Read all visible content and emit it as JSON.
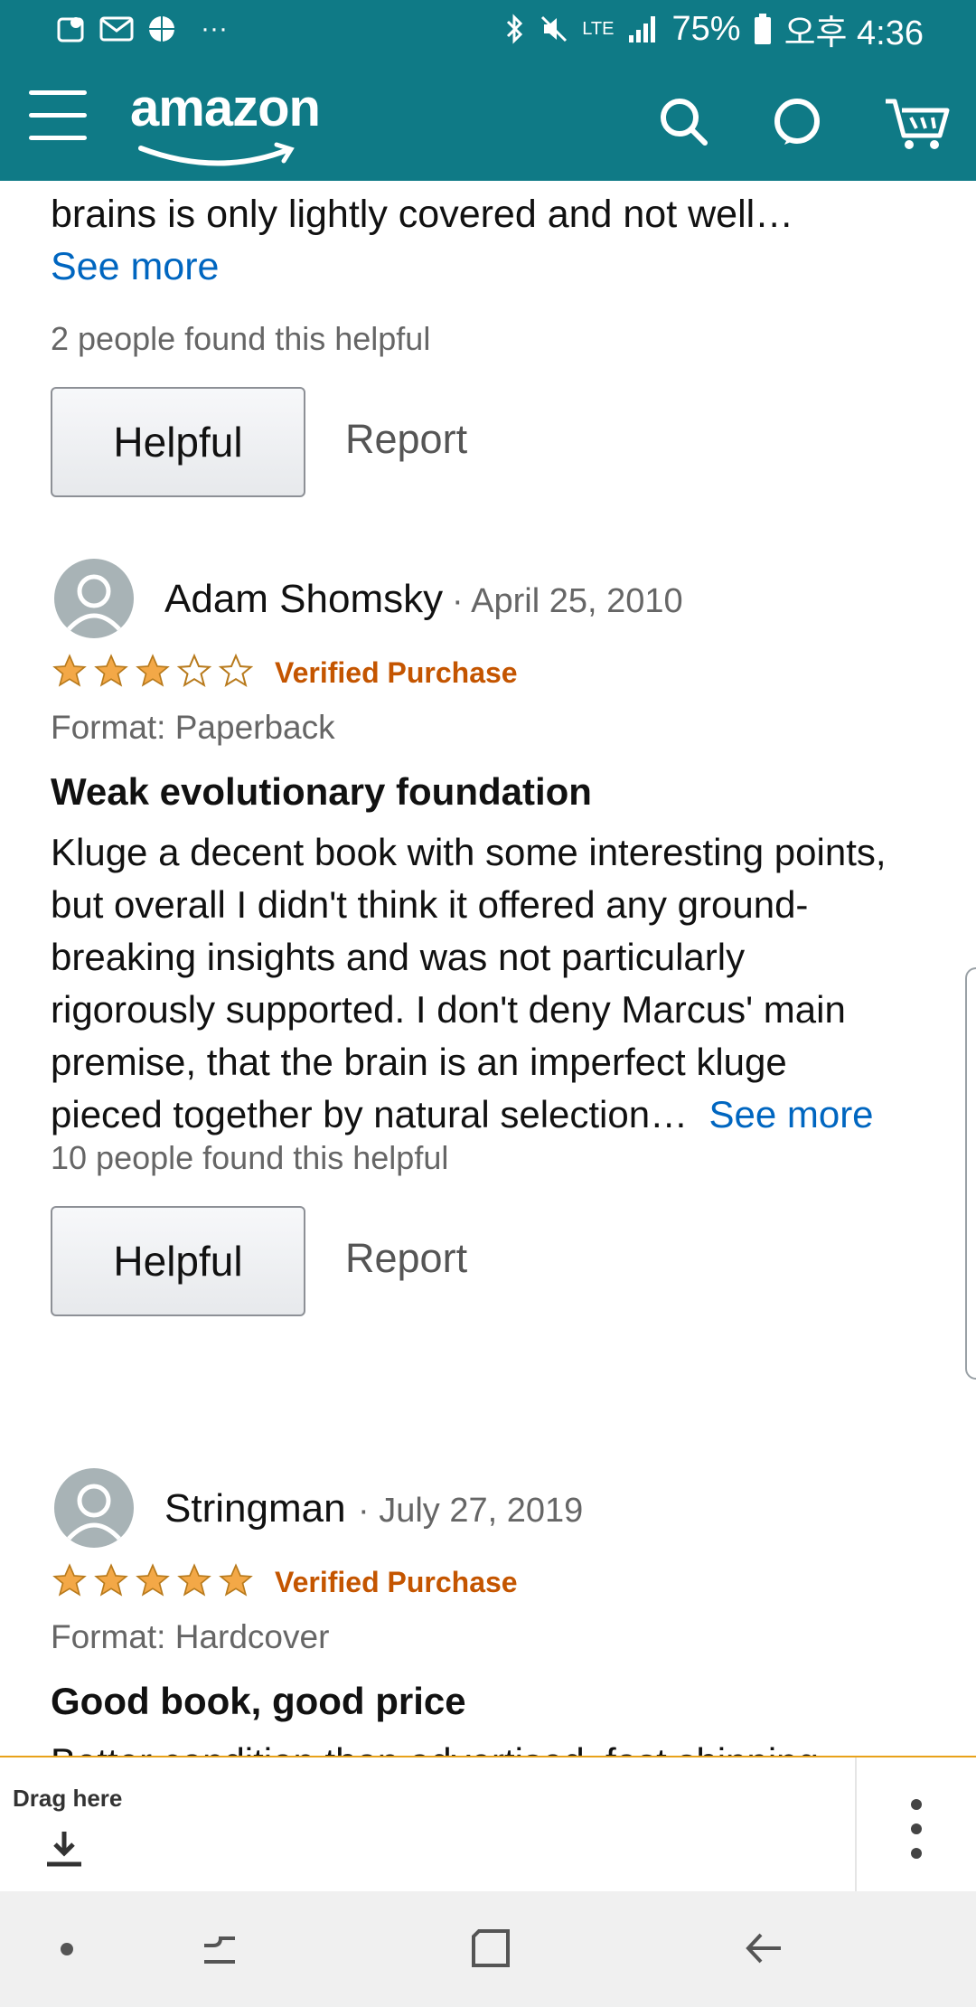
{
  "status_bar": {
    "network": "LTE",
    "battery": "75%",
    "time": "오후 4:36",
    "more": "···"
  },
  "header": {
    "brand": "amazon",
    "icons": [
      "menu-icon",
      "search-icon",
      "alexa-icon",
      "cart-icon"
    ]
  },
  "previous_review": {
    "body_tail": "brains is only lightly covered and not well…",
    "see_more": "See more",
    "helpful_count": "2 people found this helpful",
    "helpful_button": "Helpful",
    "report": "Report"
  },
  "reviews": [
    {
      "name": "Adam Shomsky",
      "date": "· April 25, 2010",
      "rating": 3,
      "verified": "Verified Purchase",
      "format": "Format: Paperback",
      "title": "Weak evolutionary foundation",
      "body": "Kluge a decent book with some interesting points, but overall I didn't think it offered any ground-breaking insights and was not particularly rigorously supported. I don't deny Marcus' main premise, that the brain is an imperfect kluge pieced together by natural selection…",
      "see_more": "See more",
      "helpful_count": "10 people found this helpful",
      "helpful_button": "Helpful",
      "report": "Report"
    },
    {
      "name": "Stringman",
      "date": "· July 27, 2019",
      "rating": 5,
      "verified": "Verified Purchase",
      "format": "Format: Hardcover",
      "title": "Good book, good price",
      "body_partial": "Better condition than advertised, fast shipping"
    }
  ],
  "drag_bar": {
    "label": "Drag here"
  },
  "colors": {
    "header": "#0f7a86",
    "link": "#0066c0",
    "verified": "#c45500",
    "star": "#f3a847"
  }
}
